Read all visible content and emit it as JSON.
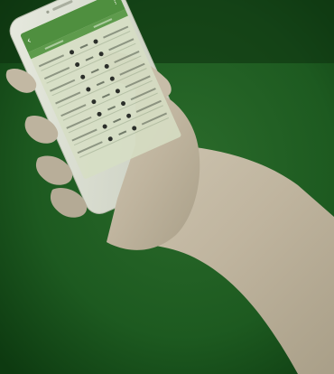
{
  "scene": {
    "background_colors": {
      "green_dark": "#0f3a12",
      "green_mid": "#1f5a22",
      "skin": "#c4b9a5",
      "phone_white": "#d9ddd0",
      "app_green": "#4f8f3f"
    },
    "icons": {
      "hand": "hand-icon",
      "phone": "smartphone-icon",
      "football": "ball-icon"
    }
  }
}
